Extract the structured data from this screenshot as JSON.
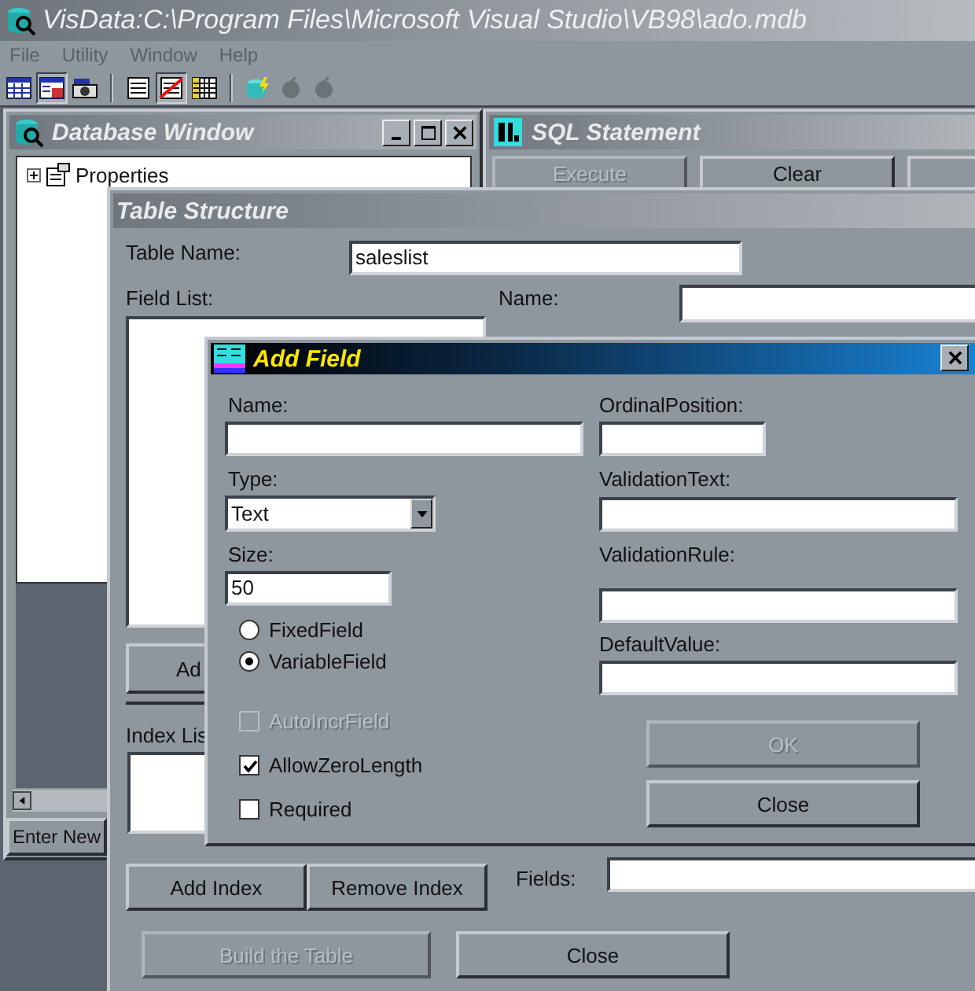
{
  "app": {
    "title": "VisData:C:\\Program Files\\Microsoft Visual Studio\\VB98\\ado.mdb",
    "menu": [
      "File",
      "Utility",
      "Window",
      "Help"
    ]
  },
  "toolbar": [
    [
      {
        "kind": "table",
        "pressed": false
      },
      {
        "kind": "form",
        "pressed": true
      },
      {
        "kind": "camera",
        "pressed": false
      }
    ],
    [
      {
        "kind": "record",
        "pressed": false
      },
      {
        "kind": "record-off",
        "pressed": true
      },
      {
        "kind": "grid",
        "pressed": false
      }
    ],
    [
      {
        "kind": "db-bolt",
        "pressed": false
      },
      {
        "kind": "apple",
        "pressed": false
      },
      {
        "kind": "apple",
        "pressed": false
      }
    ]
  ],
  "database_window": {
    "title": "Database Window",
    "tree": [
      {
        "label": "Properties",
        "expanded": false
      }
    ],
    "button": "Enter New"
  },
  "sql_window": {
    "title": "SQL Statement",
    "buttons": [
      {
        "label": "Execute",
        "disabled": true
      },
      {
        "label": "Clear",
        "disabled": false
      },
      {
        "disabled": false
      }
    ]
  },
  "table_structure": {
    "title": "Table Structure",
    "table_name_label": "Table Name:",
    "table_name": "saleslist",
    "field_list_label": "Field List:",
    "name_label": "Name:",
    "add_button": "Ad",
    "index_list_label": "Index Lis",
    "index_buttons": [
      "Add Index",
      "Remove Index"
    ],
    "fields_label": "Fields:",
    "build_button": {
      "label": "Build the Table",
      "disabled": true
    },
    "close_button": "Close"
  },
  "add_field": {
    "title": "Add Field",
    "name_label": "Name:",
    "ordinal_label": "OrdinalPosition:",
    "type_label": "Type:",
    "type_value": "Text",
    "validation_text_label": "ValidationText:",
    "size_label": "Size:",
    "size_value": "50",
    "validation_rule_label": "ValidationRule:",
    "default_value_label": "DefaultValue:",
    "radios": [
      {
        "label": "FixedField",
        "selected": false
      },
      {
        "label": "VariableField",
        "selected": true
      }
    ],
    "checks": [
      {
        "label": "AutoIncrField",
        "checked": false,
        "disabled": true
      },
      {
        "label": "AllowZeroLength",
        "checked": true,
        "disabled": false
      },
      {
        "label": "Required",
        "checked": false,
        "disabled": false
      }
    ],
    "ok_button": {
      "label": "OK",
      "disabled": true
    },
    "close_button": "Close"
  }
}
